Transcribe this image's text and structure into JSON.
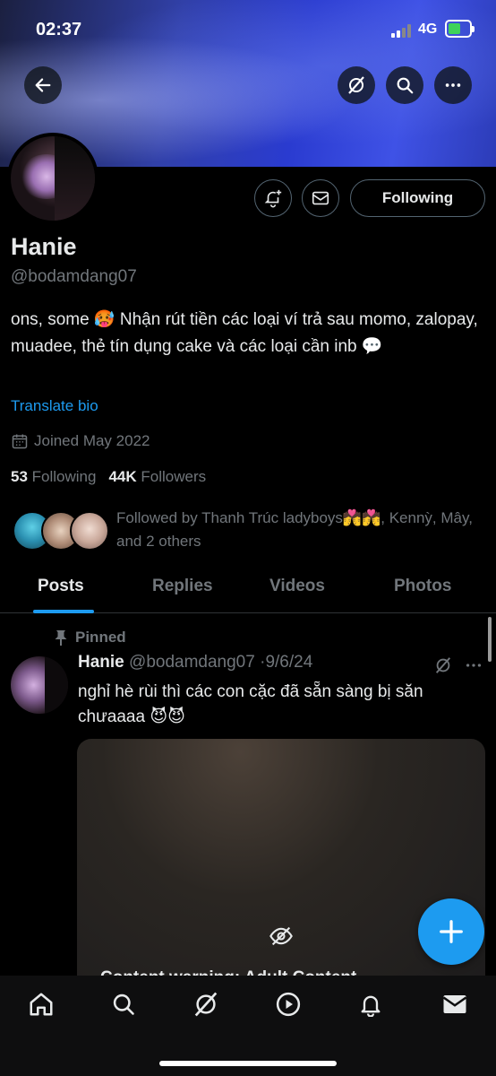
{
  "status_bar": {
    "time": "02:37",
    "network": "4G"
  },
  "profile": {
    "name": "Hanie",
    "handle": "@bodamdang07",
    "bio": "ons, some 🥵 Nhận rút tiền các loại ví trả sau momo, zalopay, muadee, thẻ tín dụng cake và các loại cần inb 💬",
    "translate_label": "Translate bio",
    "joined": "Joined May 2022",
    "following_count": "53",
    "following_label": "Following",
    "followers_count": "44K",
    "followers_label": "Followers",
    "followed_by": "Followed by Thanh Trúc ladyboys💏💏, Kennỳ, Mây, and 2 others",
    "follow_button": "Following"
  },
  "tabs": [
    {
      "label": "Posts"
    },
    {
      "label": "Replies"
    },
    {
      "label": "Videos"
    },
    {
      "label": "Photos"
    }
  ],
  "pinned_post": {
    "pinned_label": "Pinned",
    "author": "Hanie",
    "handle": "@bodamdang07",
    "date": "9/6/24",
    "text": "nghỉ hè rùi thì các con cặc đã sẵn sàng bị săn chưaaaa 😈😈",
    "media_caption": "Content warning: Adult Content"
  },
  "icons": {
    "back": "back-arrow-icon",
    "grok": "grok-icon",
    "search": "search-icon",
    "more": "more-icon",
    "notify": "bell-plus-icon",
    "message": "envelope-icon",
    "calendar": "calendar-icon",
    "pin": "pin-icon",
    "hidden": "eye-off-icon",
    "compose": "plus-icon"
  },
  "colors": {
    "accent": "#1d9bf0",
    "text": "#e7e9ea",
    "muted": "#71767b",
    "background": "#000000"
  }
}
